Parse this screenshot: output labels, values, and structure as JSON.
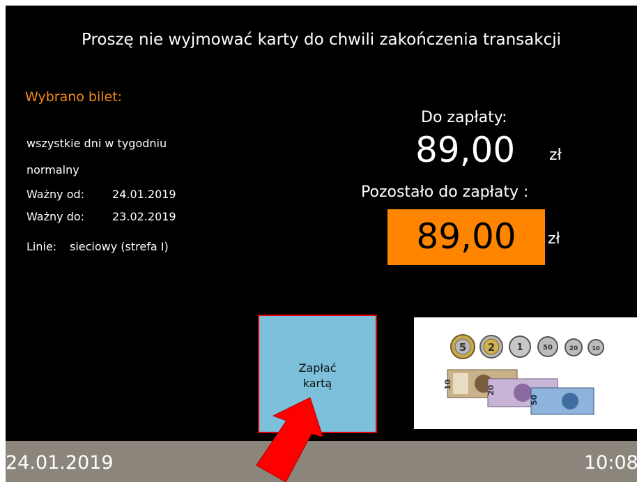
{
  "notice": "Proszę nie wyjmować karty do chwili zakończenia transakcji",
  "ticket": {
    "title": "Wybrano bilet:",
    "days": "wszystkie dni w tygodniu",
    "type": "normalny",
    "valid_from_label": "Ważny od:",
    "valid_from": "24.01.2019",
    "valid_to_label": "Ważny do:",
    "valid_to": "23.02.2019",
    "lines_label": "Linie:",
    "lines": "sieciowy (strefa I)"
  },
  "payment": {
    "to_pay_label": "Do zapłaty:",
    "to_pay_value": "89,00",
    "currency": "zł",
    "remaining_label": "Pozostało do zapłaty :",
    "remaining_value": "89,00"
  },
  "pay_card_button": {
    "line1": "Zapłać",
    "line2": "kartą"
  },
  "cash_panel": {
    "coins": [
      "5",
      "2",
      "1",
      "50",
      "20",
      "10"
    ],
    "banknotes": [
      "10",
      "20",
      "50"
    ]
  },
  "status_bar": {
    "date": "24.01.2019",
    "time": "10:08"
  },
  "colors": {
    "accent_orange": "#ff8400",
    "title_orange": "#f38a16",
    "button_blue": "#7cc0db",
    "button_border": "#e00000",
    "arrow_red": "#ff0000"
  }
}
